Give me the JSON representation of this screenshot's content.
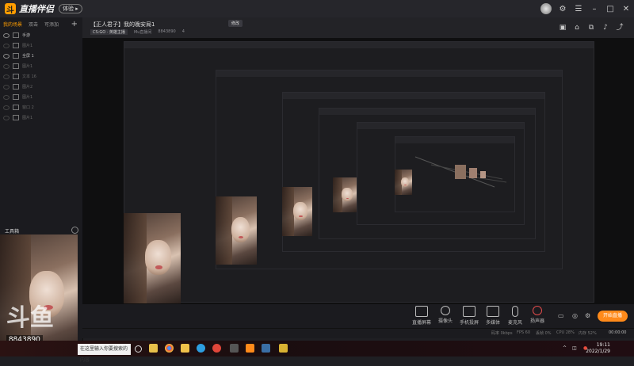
{
  "app": {
    "logo_mark": "斗",
    "name": "直播伴侣",
    "badge": "体验 ▸"
  },
  "sidebar": {
    "tabs": [
      "我的场景",
      "双击",
      "可添加"
    ],
    "sources": [
      "手游",
      "图片1",
      "全屏 1",
      "图片1",
      "文本 16",
      "图片2",
      "图片1",
      "窗口 2",
      "图片1"
    ],
    "tool_label": "工具箱"
  },
  "header": {
    "title": "【正人君子】我的晚安局1",
    "edit_label": "修改",
    "category": "CS:GO · 英雄主播",
    "meta": [
      "Mu直播间",
      "8843890",
      "4"
    ]
  },
  "preview": {
    "overlay_id": "8843890",
    "watermark": "斗鱼"
  },
  "bottom_bar": {
    "tools": [
      "直播屏幕",
      "摄像头",
      "手机投屏",
      "多媒体",
      "麦克风",
      "扬声器"
    ],
    "start_label": "开始直播",
    "timer": "00:00:00"
  },
  "status_bar": {
    "items": [
      "码率 0kbps",
      "FPS 60",
      "丢帧 0%",
      "CPU 28%",
      "内存 52%"
    ]
  },
  "taskbar": {
    "search_placeholder": "在这里输入你要搜索的内容",
    "time": "19:11",
    "date": "2022/1/29"
  },
  "colors": {
    "accent": "#ff8a1a",
    "background": "#1f1f23"
  }
}
